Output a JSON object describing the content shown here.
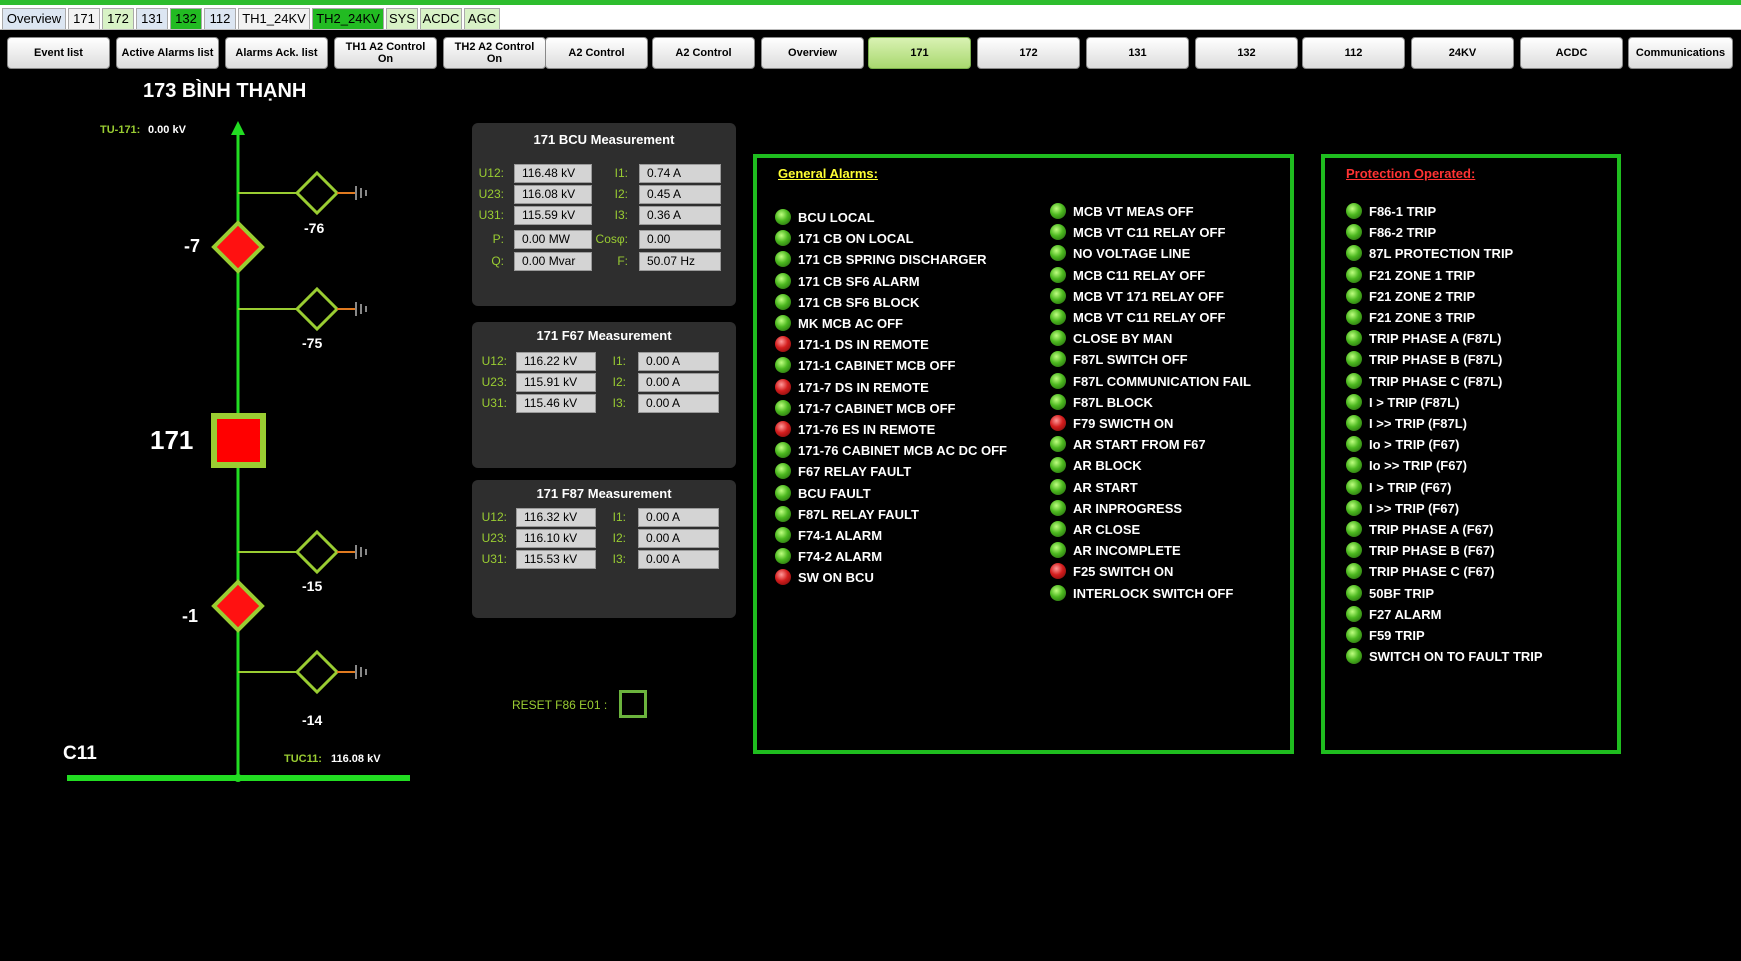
{
  "colors": {
    "accent": "#2ebd2e",
    "label": "#9acd32",
    "alarm_red": "#d41d1d",
    "ok_green": "#4cb81f",
    "breaker_red": "#ff0000",
    "border_green": "#1fbd1f"
  },
  "top_tabs": [
    {
      "label": "Overview",
      "bg": "#dce6f2"
    },
    {
      "label": "171",
      "bg": "#f2f2f2"
    },
    {
      "label": "172",
      "bg": "#d8f2c6"
    },
    {
      "label": "131",
      "bg": "#dce6f2"
    },
    {
      "label": "132",
      "bg": "#22bb22"
    },
    {
      "label": "112",
      "bg": "#dce6f2"
    },
    {
      "label": "TH1_24KV",
      "bg": "#f2f2f2"
    },
    {
      "label": "TH2_24KV",
      "bg": "#22bb22"
    },
    {
      "label": "SYS",
      "bg": "#d8f2c6"
    },
    {
      "label": "ACDC",
      "bg": "#d8f2c6"
    },
    {
      "label": "AGC",
      "bg": "#d8f2c6"
    }
  ],
  "nav_buttons": [
    "Event list",
    "Active Alarms list",
    "Alarms Ack. list",
    "TH1 A2 Control On",
    "TH2 A2 Control On",
    "A2 Control",
    "A2 Control",
    "Overview",
    "171",
    "172",
    "131",
    "132",
    "112",
    "24KV",
    "ACDC",
    "Communications"
  ],
  "nav_active_label": "171",
  "sld": {
    "title": "173 BÌNH THẠNH",
    "tu_label": "TU-171:",
    "tu_value": "0.00 kV",
    "switch_a_label": "-7",
    "es_a1_label": "-76",
    "es_a2_label": "-75",
    "breaker_label": "171",
    "switch_b_label": "-1",
    "es_b1_label": "-15",
    "es_b2_label": "-14",
    "bus_label": "C11",
    "tuc_label": "TUC11:",
    "tuc_value": "116.08 kV",
    "reset_label": "RESET F86 E01 :"
  },
  "measurements": {
    "bcu": {
      "title": "171 BCU Measurement",
      "labels_left": [
        "U12:",
        "U23:",
        "U31:",
        "P:",
        "Q:"
      ],
      "values_left": [
        "116.48 kV",
        "116.08 kV",
        "115.59 kV",
        "0.00 MW",
        "0.00 Mvar"
      ],
      "labels_right": [
        "I1:",
        "I2:",
        "I3:",
        "Cosφ:",
        "F:"
      ],
      "values_right": [
        "0.74 A",
        "0.45 A",
        "0.36 A",
        "0.00",
        "50.07 Hz"
      ]
    },
    "f67": {
      "title": "171 F67  Measurement",
      "labels_left": [
        "U12:",
        "U23:",
        "U31:"
      ],
      "values_left": [
        "116.22 kV",
        "115.91 kV",
        "115.46 kV"
      ],
      "labels_right": [
        "I1:",
        "I2:",
        "I3:"
      ],
      "values_right": [
        "0.00 A",
        "0.00 A",
        "0.00 A"
      ]
    },
    "f87": {
      "title": "171 F87 Measurement",
      "labels_left": [
        "U12:",
        "U23:",
        "U31:"
      ],
      "values_left": [
        "116.32 kV",
        "116.10 kV",
        "115.53 kV"
      ],
      "labels_right": [
        "I1:",
        "I2:",
        "I3:"
      ],
      "values_right": [
        "0.00 A",
        "0.00 A",
        "0.00 A"
      ]
    }
  },
  "general_alarms": {
    "title": "General Alarms:",
    "title_color": "#ffff33",
    "col1": [
      {
        "label": "BCU LOCAL",
        "state": "g"
      },
      {
        "label": "171 CB ON LOCAL",
        "state": "g"
      },
      {
        "label": "171 CB SPRING DISCHARGER",
        "state": "g"
      },
      {
        "label": "171 CB SF6 ALARM",
        "state": "g"
      },
      {
        "label": "171 CB SF6 BLOCK",
        "state": "g"
      },
      {
        "label": "MK MCB AC OFF",
        "state": "g"
      },
      {
        "label": "171-1 DS IN REMOTE",
        "state": "r"
      },
      {
        "label": "171-1 CABINET MCB OFF",
        "state": "g"
      },
      {
        "label": "171-7 DS IN REMOTE",
        "state": "r"
      },
      {
        "label": "171-7 CABINET MCB OFF",
        "state": "g"
      },
      {
        "label": "171-76 ES IN REMOTE",
        "state": "r"
      },
      {
        "label": "171-76 CABINET MCB AC DC OFF",
        "state": "g"
      },
      {
        "label": "F67 RELAY FAULT",
        "state": "g"
      },
      {
        "label": "BCU FAULT",
        "state": "g"
      },
      {
        "label": "F87L RELAY FAULT",
        "state": "g"
      },
      {
        "label": "F74-1 ALARM",
        "state": "g"
      },
      {
        "label": "F74-2 ALARM",
        "state": "g"
      },
      {
        "label": "SW ON BCU",
        "state": "r"
      }
    ],
    "col2": [
      {
        "label": "MCB VT MEAS OFF",
        "state": "g"
      },
      {
        "label": "MCB VT C11 RELAY OFF",
        "state": "g"
      },
      {
        "label": "NO VOLTAGE LINE",
        "state": "g"
      },
      {
        "label": "MCB C11 RELAY OFF",
        "state": "g"
      },
      {
        "label": "MCB VT 171 RELAY OFF",
        "state": "g"
      },
      {
        "label": "MCB VT C11 RELAY OFF",
        "state": "g"
      },
      {
        "label": "CLOSE BY MAN",
        "state": "g"
      },
      {
        "label": "F87L SWITCH OFF",
        "state": "g"
      },
      {
        "label": "F87L COMMUNICATION FAIL",
        "state": "g"
      },
      {
        "label": "F87L BLOCK",
        "state": "g"
      },
      {
        "label": "F79 SWICTH ON",
        "state": "r"
      },
      {
        "label": "AR START FROM F67",
        "state": "g"
      },
      {
        "label": "AR BLOCK",
        "state": "g"
      },
      {
        "label": "AR START",
        "state": "g"
      },
      {
        "label": "AR INPROGRESS",
        "state": "g"
      },
      {
        "label": "AR CLOSE",
        "state": "g"
      },
      {
        "label": "AR INCOMPLETE",
        "state": "g"
      },
      {
        "label": "F25 SWITCH ON",
        "state": "r"
      },
      {
        "label": "INTERLOCK SWITCH OFF",
        "state": "g"
      }
    ]
  },
  "protection_operated": {
    "title": "Protection Operated:",
    "title_color": "#ff3333",
    "items": [
      {
        "label": "F86-1 TRIP",
        "state": "g"
      },
      {
        "label": "F86-2 TRIP",
        "state": "g"
      },
      {
        "label": "87L PROTECTION TRIP",
        "state": "g"
      },
      {
        "label": "F21 ZONE 1 TRIP",
        "state": "g"
      },
      {
        "label": "F21 ZONE 2 TRIP",
        "state": "g"
      },
      {
        "label": "F21 ZONE 3 TRIP",
        "state": "g"
      },
      {
        "label": "TRIP PHASE A (F87L)",
        "state": "g"
      },
      {
        "label": "TRIP PHASE B (F87L)",
        "state": "g"
      },
      {
        "label": "TRIP PHASE C (F87L)",
        "state": "g"
      },
      {
        "label": "I > TRIP (F87L)",
        "state": "g"
      },
      {
        "label": "I >> TRIP (F87L)",
        "state": "g"
      },
      {
        "label": "Io > TRIP (F67)",
        "state": "g"
      },
      {
        "label": "Io >> TRIP (F67)",
        "state": "g"
      },
      {
        "label": "I > TRIP (F67)",
        "state": "g"
      },
      {
        "label": "I >> TRIP (F67)",
        "state": "g"
      },
      {
        "label": "TRIP PHASE A (F67)",
        "state": "g"
      },
      {
        "label": "TRIP PHASE B (F67)",
        "state": "g"
      },
      {
        "label": "TRIP PHASE C (F67)",
        "state": "g"
      },
      {
        "label": "50BF TRIP",
        "state": "g"
      },
      {
        "label": "F27 ALARM",
        "state": "g"
      },
      {
        "label": "F59 TRIP",
        "state": "g"
      },
      {
        "label": "SWITCH ON TO FAULT TRIP",
        "state": "g"
      }
    ]
  }
}
